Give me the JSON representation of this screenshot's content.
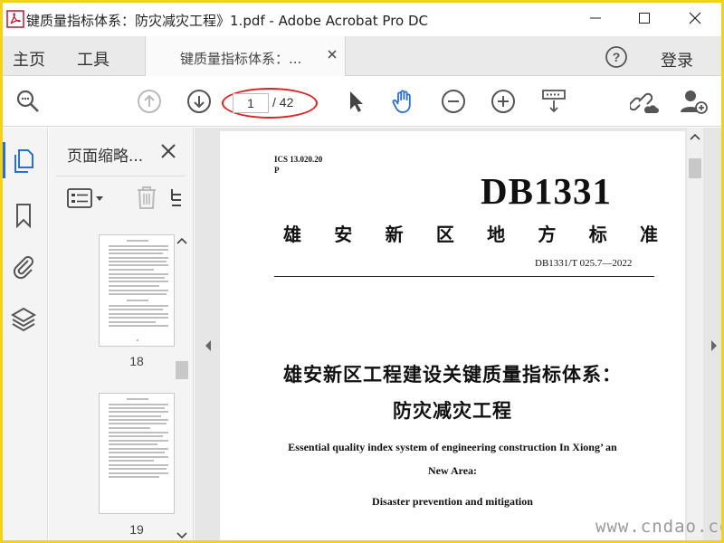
{
  "window": {
    "title": "键质量指标体系：防灾减灾工程》1.pdf - Adobe Acrobat Pro DC"
  },
  "menu": {
    "home": "主页",
    "tools": "工具",
    "doc_tab": "键质量指标体系：...",
    "login": "登录"
  },
  "toolbar": {
    "current_page": "1",
    "total_pages": "/ 42"
  },
  "thumbnails": {
    "panel_title": "页面缩略...",
    "items": [
      {
        "page": "18"
      },
      {
        "page": "19"
      }
    ]
  },
  "document": {
    "ics": "ICS 13.020.20",
    "ics_p": "P",
    "code": "DB1331",
    "standard_chars": [
      "雄",
      "安",
      "新",
      "区",
      "地",
      "方",
      "标",
      "准"
    ],
    "standard_number": "DB1331/T 025.7—2022",
    "title_line1": "雄安新区工程建设关键质量指标体系：",
    "title_line2": "防灾减灾工程",
    "english_line1": "Essential quality index system of engineering construction In Xiong’ an",
    "english_line2": "New Area:",
    "english_line3": "Disaster prevention and mitigation"
  },
  "watermark": "www.cndao.com",
  "colors": {
    "accent": "#2a6fd1",
    "annotation_oval": "#dd2222",
    "frame": "#f2d21a"
  }
}
